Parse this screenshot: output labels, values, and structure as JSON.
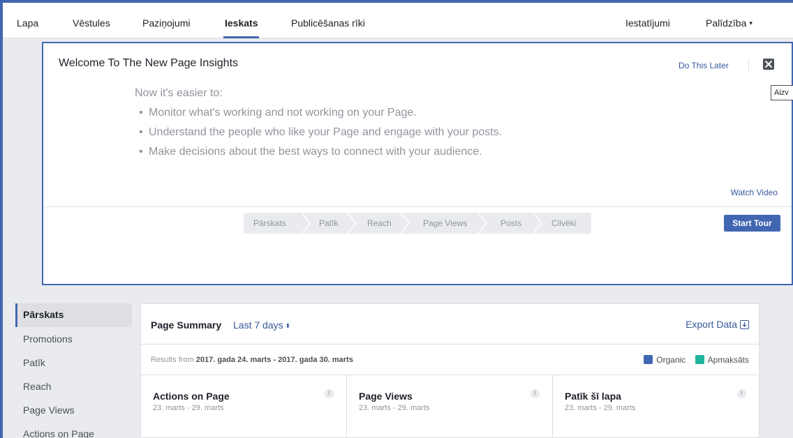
{
  "nav": {
    "items": [
      {
        "label": "Lapa"
      },
      {
        "label": "Vēstules"
      },
      {
        "label": "Paziņojumi"
      },
      {
        "label": "Ieskats"
      },
      {
        "label": "Publicēšanas rīki"
      }
    ],
    "active": "Ieskats",
    "settings": "Iestatījumi",
    "help": "Palīdzība",
    "help_caret": "▾"
  },
  "welcome": {
    "title": "Welcome To The New Page Insights",
    "do_later": "Do This Later",
    "intro": "Now it's easier to:",
    "bullets": [
      "Monitor what's working and not working on your Page.",
      "Understand the people who like your Page and engage with your posts.",
      "Make decisions about the best ways to connect with your audience."
    ],
    "bullet_glyph": "•",
    "watch_video": "Watch Video",
    "steps": [
      "Pārskats",
      "Patīk",
      "Reach",
      "Page Views",
      "Posts",
      "Cilvēki"
    ],
    "start_tour": "Start Tour",
    "close_icon": "close-icon"
  },
  "tooltip": "Aizv",
  "sidebar": {
    "items": [
      "Pārskats",
      "Promotions",
      "Patīk",
      "Reach",
      "Page Views",
      "Actions on Page"
    ],
    "active": "Pārskats"
  },
  "summary": {
    "title": "Page Summary",
    "range": "Last 7 days",
    "range_icon": "⬍",
    "export": "Export Data",
    "results_prefix": "Results from ",
    "results_range": "2017. gada 24. marts - 2017. gada 30. marts",
    "legend": [
      {
        "label": "Organic",
        "color": "#4267b2"
      },
      {
        "label": "Apmaksāts",
        "color": "#20b39e"
      }
    ],
    "metrics": [
      {
        "title": "Actions on Page",
        "date": "23. marts - 29. marts"
      },
      {
        "title": "Page Views",
        "date": "23. marts - 29. marts"
      },
      {
        "title": "Patīk šī lapa",
        "date": "23. marts - 29. marts"
      }
    ],
    "info_glyph": "i"
  },
  "colors": {
    "accent": "#4267b2",
    "link": "#365899",
    "paid": "#20b39e"
  }
}
